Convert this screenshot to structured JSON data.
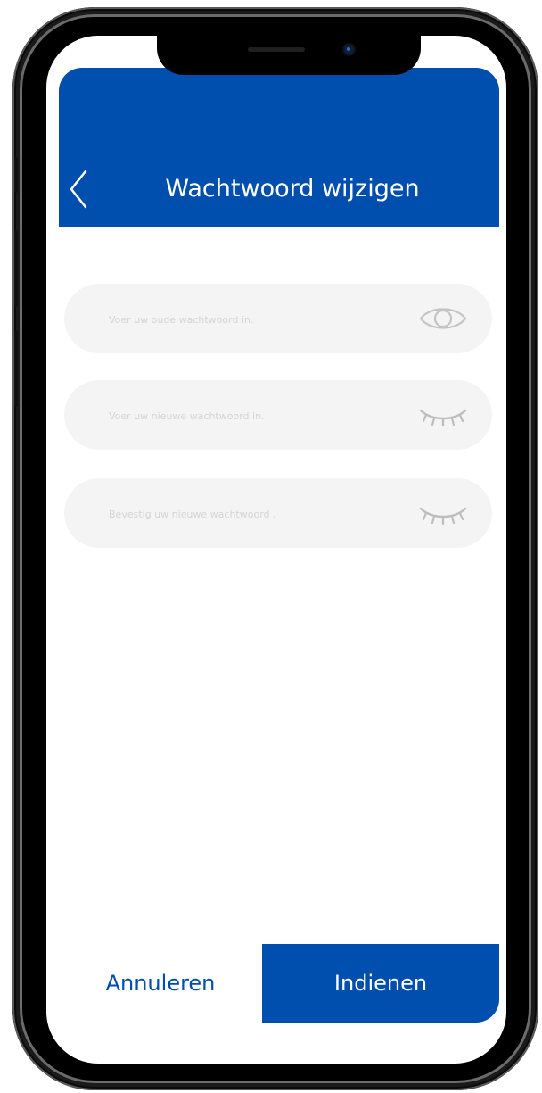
{
  "app": {
    "title": "Wachtwoord wijzigen",
    "accent_color": "#004ead"
  },
  "header": {
    "back_icon": "chevron-left-icon"
  },
  "form": {
    "fields": [
      {
        "placeholder": "Voer uw oude wachtwoord in.",
        "value": "",
        "visibility_icon": "eye-open-icon"
      },
      {
        "placeholder": "Voer uw nieuwe wachtwoord in.",
        "value": "",
        "visibility_icon": "eye-closed-icon"
      },
      {
        "placeholder": "Bevestig uw nieuwe wachtwoord .",
        "value": "",
        "visibility_icon": "eye-closed-icon"
      }
    ]
  },
  "footer": {
    "cancel_label": "Annuleren",
    "submit_label": "Indienen"
  }
}
